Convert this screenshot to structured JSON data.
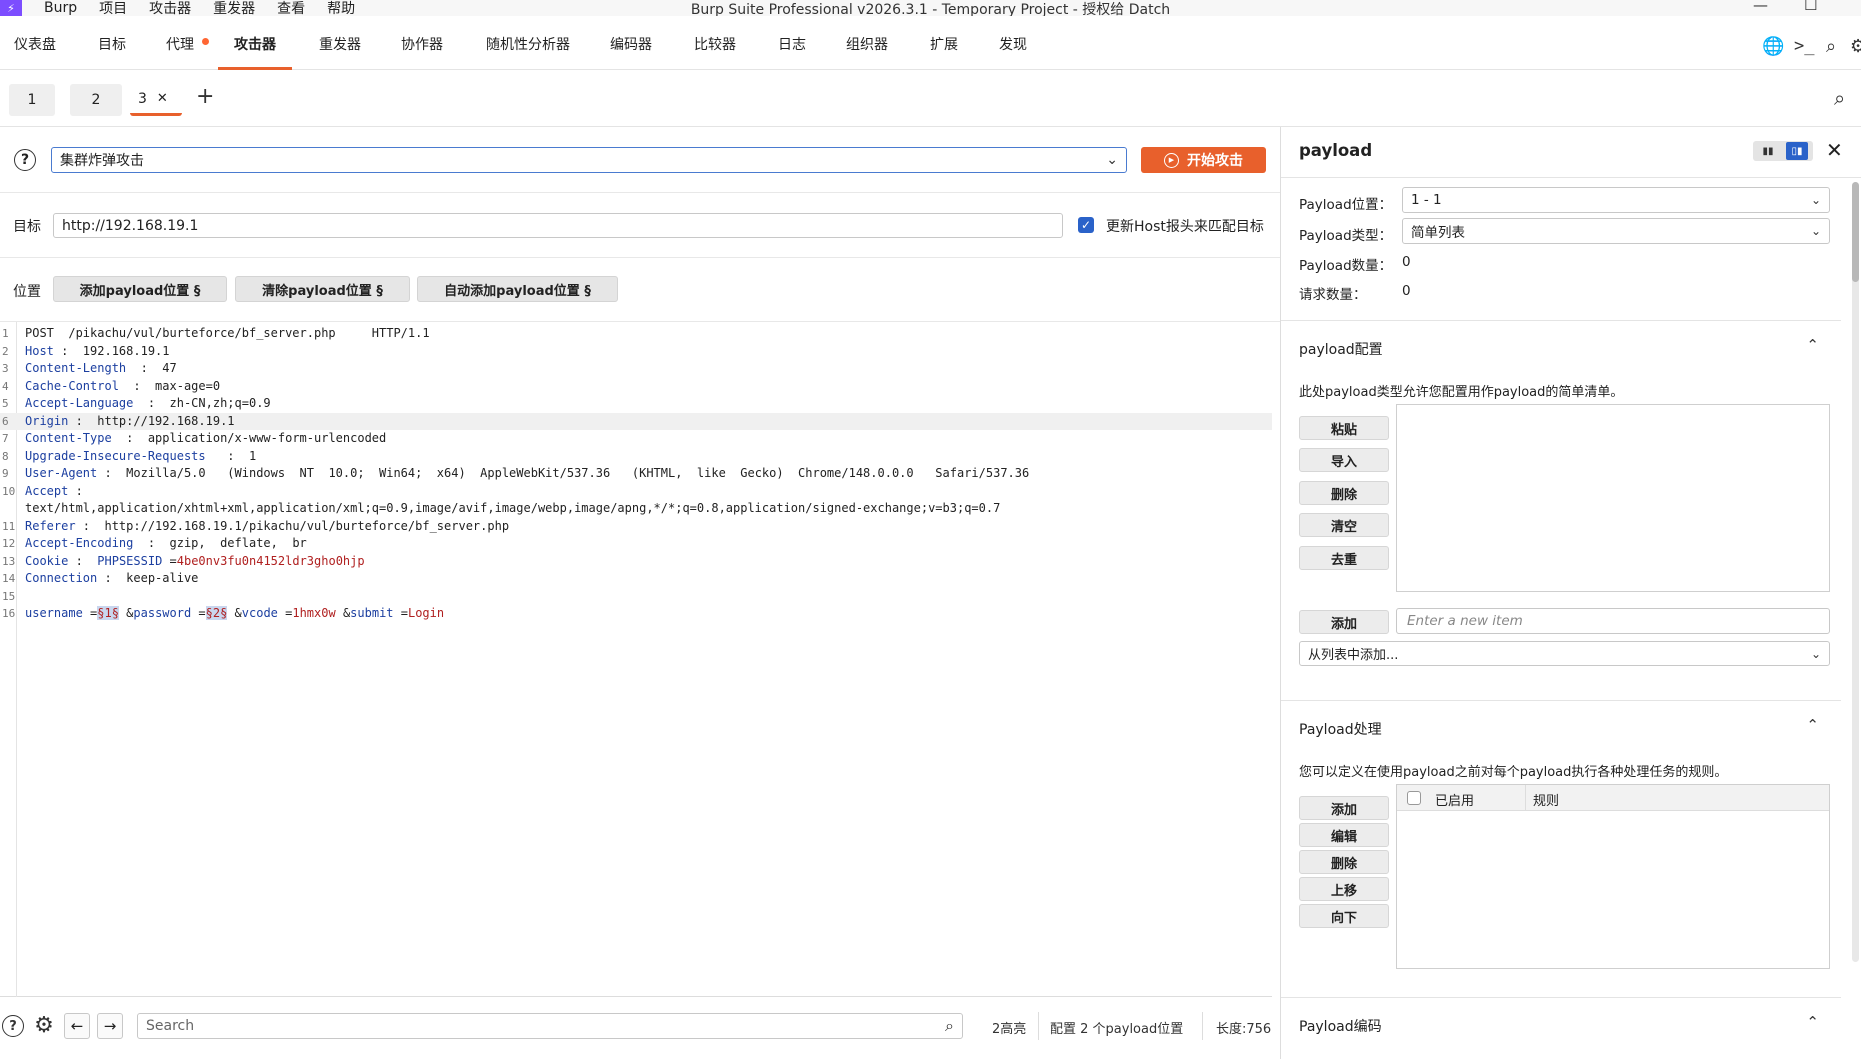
{
  "app": {
    "window_title": "Burp Suite Professional v2026.3.1 - Temporary Project - 授权给 Datch",
    "menu": [
      "Burp",
      "项目",
      "攻击器",
      "重发器",
      "查看",
      "帮助"
    ]
  },
  "main_tabs": [
    "仪表盘",
    "目标",
    "代理",
    "攻击器",
    "重发器",
    "协作器",
    "随机性分析器",
    "编码器",
    "比较器",
    "日志",
    "组织器",
    "扩展",
    "发现"
  ],
  "main_tabs_active": "攻击器",
  "sub_tabs": [
    "1",
    "2",
    "3"
  ],
  "sub_tab_add": "+",
  "attack": {
    "type_value": "集群炸弹攻击",
    "start_label": "开始攻击"
  },
  "target": {
    "label": "目标",
    "value": "http://192.168.19.1",
    "update_host_label": "更新Host报头来匹配目标",
    "update_host_checked": true
  },
  "positions": {
    "label": "位置",
    "add_label": "添加payload位置 §",
    "clear_label": "清除payload位置 §",
    "auto_label": "自动添加payload位置 §"
  },
  "request_lines": [
    {
      "n": "1",
      "parts": [
        {
          "t": "POST  /pikachu/vul/burteforce/bf_server.php     HTTP/1.1",
          "c": "v"
        }
      ]
    },
    {
      "n": "2",
      "parts": [
        {
          "t": "Host",
          "c": "k"
        },
        {
          "t": " :  192.168.19.1",
          "c": "v"
        }
      ]
    },
    {
      "n": "3",
      "parts": [
        {
          "t": "Content-Length",
          "c": "k"
        },
        {
          "t": "  :  47",
          "c": "v"
        }
      ]
    },
    {
      "n": "4",
      "parts": [
        {
          "t": "Cache-Control",
          "c": "k"
        },
        {
          "t": "  :  max-age=0",
          "c": "v"
        }
      ]
    },
    {
      "n": "5",
      "parts": [
        {
          "t": "Accept-Language",
          "c": "k"
        },
        {
          "t": "  :  zh-CN,zh;q=0.9",
          "c": "v"
        }
      ]
    },
    {
      "n": "6",
      "parts": [
        {
          "t": "Origin",
          "c": "k"
        },
        {
          "t": " :  http://192.168.19.1",
          "c": "v"
        }
      ]
    },
    {
      "n": "7",
      "parts": [
        {
          "t": "Content-Type",
          "c": "k"
        },
        {
          "t": "  :  application/x-www-form-urlencoded",
          "c": "v"
        }
      ]
    },
    {
      "n": "8",
      "parts": [
        {
          "t": "Upgrade-Insecure-Requests",
          "c": "k"
        },
        {
          "t": "   :  1",
          "c": "v"
        }
      ]
    },
    {
      "n": "9",
      "parts": [
        {
          "t": "User-Agent",
          "c": "k"
        },
        {
          "t": " :  Mozilla/5.0   (Windows  NT  10.0;  Win64;  x64)  AppleWebKit/537.36   (KHTML,  like  Gecko)  Chrome/148.0.0.0   Safari/537.36",
          "c": "v"
        }
      ]
    },
    {
      "n": "10",
      "parts": [
        {
          "t": "Accept",
          "c": "k"
        },
        {
          "t": " :",
          "c": "v"
        }
      ]
    },
    {
      "n": "",
      "parts": [
        {
          "t": "text/html,application/xhtml+xml,application/xml;q=0.9,image/avif,image/webp,image/apng,*/*;q=0.8,application/signed-exchange;v=b3;q=0.7",
          "c": "v"
        }
      ]
    },
    {
      "n": "11",
      "parts": [
        {
          "t": "Referer",
          "c": "k"
        },
        {
          "t": " :  http://192.168.19.1/pikachu/vul/burteforce/bf_server.php",
          "c": "v"
        }
      ]
    },
    {
      "n": "12",
      "parts": [
        {
          "t": "Accept-Encoding",
          "c": "k"
        },
        {
          "t": "  :  gzip,  deflate,  br",
          "c": "v"
        }
      ]
    },
    {
      "n": "13",
      "parts": [
        {
          "t": "Cookie",
          "c": "k"
        },
        {
          "t": " :  ",
          "c": "v"
        },
        {
          "t": "PHPSESSID",
          "c": "k"
        },
        {
          "t": " =",
          "c": "v"
        },
        {
          "t": "4be0nv3fu0n4152ldr3gho0hjp",
          "c": "r"
        }
      ]
    },
    {
      "n": "14",
      "parts": [
        {
          "t": "Connection",
          "c": "k"
        },
        {
          "t": " :  keep-alive",
          "c": "v"
        }
      ]
    },
    {
      "n": "15",
      "parts": []
    },
    {
      "n": "16",
      "parts": [
        {
          "t": "username",
          "c": "k"
        },
        {
          "t": " =",
          "c": "v"
        },
        {
          "t": "§1§",
          "c": "m"
        },
        {
          "t": " &",
          "c": "v"
        },
        {
          "t": "password",
          "c": "k"
        },
        {
          "t": " =",
          "c": "v"
        },
        {
          "t": "§2§",
          "c": "m"
        },
        {
          "t": " &",
          "c": "v"
        },
        {
          "t": "vcode",
          "c": "k"
        },
        {
          "t": " =",
          "c": "v"
        },
        {
          "t": "1hmx0w",
          "c": "r"
        },
        {
          "t": " &",
          "c": "v"
        },
        {
          "t": "submit",
          "c": "k"
        },
        {
          "t": " =",
          "c": "v"
        },
        {
          "t": "Login",
          "c": "r"
        }
      ]
    }
  ],
  "highlighted_line": "6",
  "bottom": {
    "search_placeholder": "Search",
    "highlights": "2高亮",
    "config": "配置 2 个payload位置",
    "length": "长度:756"
  },
  "payload_panel": {
    "title": "payload",
    "position_label": "Payload位置：",
    "position_value": "1 - 1",
    "type_label": "Payload类型：",
    "type_value": "简单列表",
    "count_label": "Payload数量：",
    "count_value": "0",
    "requests_label": "请求数量：",
    "requests_value": "0",
    "config_section": {
      "title": "payload配置",
      "desc": "此处payload类型允许您配置用作payload的简单清单。",
      "buttons": [
        "粘贴",
        "导入",
        "删除",
        "清空",
        "去重"
      ],
      "add_label": "添加",
      "new_item_placeholder": "Enter a new item",
      "from_list_label": "从列表中添加..."
    },
    "processing_section": {
      "title": "Payload处理",
      "desc": "您可以定义在使用payload之前对每个payload执行各种处理任务的规则。",
      "buttons": [
        "添加",
        "编辑",
        "删除",
        "上移",
        "向下"
      ],
      "col_enabled": "已启用",
      "col_rule": "规则"
    },
    "encoding_section": {
      "title": "Payload编码"
    }
  },
  "colors": {
    "accent": "#e8602c",
    "key": "#1c3fa0",
    "value_red": "#b02020",
    "checkbox": "#2a62c9"
  }
}
